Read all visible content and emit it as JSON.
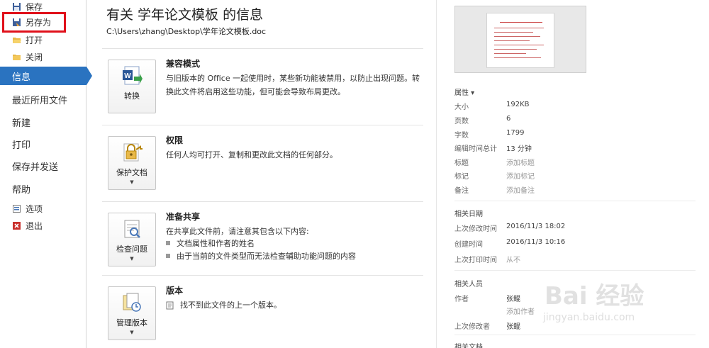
{
  "sidebar": {
    "save": "保存",
    "save_as": "另存为",
    "open": "打开",
    "close": "关闭",
    "info": "信息",
    "recent": "最近所用文件",
    "new": "新建",
    "print": "打印",
    "save_send": "保存并发送",
    "help": "帮助",
    "options": "选项",
    "exit": "退出"
  },
  "main": {
    "title": "有关 学年论文模板 的信息",
    "path": "C:\\Users\\zhang\\Desktop\\学年论文模板.doc",
    "compat": {
      "button": "转换",
      "heading": "兼容模式",
      "desc": "与旧版本的 Office 一起使用时，某些新功能被禁用，以防止出现问题。转换此文件将启用这些功能，但可能会导致布局更改。"
    },
    "permissions": {
      "button": "保护文档",
      "heading": "权限",
      "desc": "任何人均可打开、复制和更改此文档的任何部分。"
    },
    "prepare": {
      "button": "检查问题",
      "heading": "准备共享",
      "desc": "在共享此文件前，请注意其包含以下内容:",
      "bullets": [
        "文档属性和作者的姓名",
        "由于当前的文件类型而无法检查辅助功能问题的内容"
      ]
    },
    "versions": {
      "button": "管理版本",
      "heading": "版本",
      "desc": "找不到此文件的上一个版本。"
    }
  },
  "properties": {
    "header": "属性 ▾",
    "size_label": "大小",
    "size": "192KB",
    "pages_label": "页数",
    "pages": "6",
    "words_label": "字数",
    "words": "1799",
    "edit_time_label": "编辑时间总计",
    "edit_time": "13 分钟",
    "title_label": "标题",
    "title_add": "添加标题",
    "tags_label": "标记",
    "tags_add": "添加标记",
    "comments_label": "备注",
    "comments_add": "添加备注"
  },
  "dates": {
    "header": "相关日期",
    "modified_label": "上次修改时间",
    "modified": "2016/11/3 18:02",
    "created_label": "创建时间",
    "created": "2016/11/3 10:16",
    "printed_label": "上次打印时间",
    "printed": "从不"
  },
  "people": {
    "header": "相关人员",
    "author_label": "作者",
    "author": "张鲲",
    "add_author": "添加作者",
    "last_modified_by_label": "上次修改者",
    "last_modified_by": "张鲲"
  },
  "docs": {
    "header": "相关文档"
  },
  "watermark": {
    "brand": "Bai 经验",
    "url": "jingyan.baidu.com"
  }
}
